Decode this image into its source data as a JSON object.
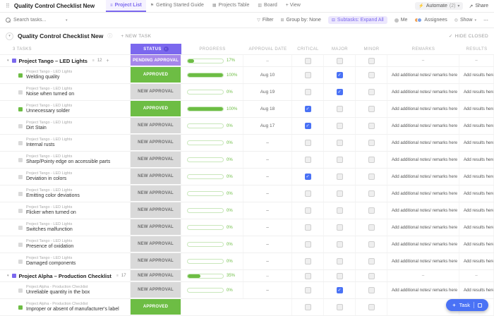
{
  "accent": "#7b68ee",
  "icons": {
    "grid": "⠿",
    "list": "≡",
    "guide": "⚑",
    "table": "▦",
    "board": "▥",
    "lightning": "⚡",
    "share": "↗",
    "caret": "▾",
    "filter": "▽",
    "group_by": "⊞",
    "subtasks": "⊟",
    "show": "◎",
    "more": "⋯",
    "info": "ⓘ",
    "check": "✓",
    "sort": "↑",
    "plus": "+",
    "collapse": "▾",
    "count_branch": "≡"
  },
  "topbar": {
    "title": "Quality Control Checklist New",
    "tabs": [
      {
        "label": "Project List"
      },
      {
        "label": "Getting Started Guide"
      },
      {
        "label": "Projects Table"
      },
      {
        "label": "Board"
      }
    ],
    "add_view": "+ View",
    "automate": "Automate",
    "automate_count": "(2)",
    "share": "Share"
  },
  "toolbar": {
    "search_placeholder": "Search tasks...",
    "filter": "Filter",
    "group_by": "Group by: None",
    "subtasks": "Subtasks: Expand All",
    "me": "Me",
    "assignees": "Assignees",
    "show": "Show"
  },
  "listbar": {
    "title": "Quality Control Checklist New",
    "new_task": "+ NEW TASK",
    "hide_closed": "HIDE CLOSED"
  },
  "table": {
    "tasks_count_label": "3 TASKS",
    "columns": {
      "status": "STATUS",
      "progress": "PROGRESS",
      "approval_date": "APPROVAL DATE",
      "critical": "CRITICAL",
      "major": "MAJOR",
      "minor": "MINOR",
      "remarks": "REMARKS",
      "results": "RESULTS"
    },
    "statuses": {
      "PENDING APPROVAL": {
        "bg": "#a687ea",
        "fg": "#ffffff"
      },
      "APPROVED": {
        "bg": "#6dbd44",
        "fg": "#ffffff"
      },
      "NEW APPROVAL": {
        "bg": "#d9d9d9",
        "fg": "#6e6e6e"
      }
    },
    "rows": [
      {
        "type": "group",
        "title": "Project Tango – LED Lights",
        "count": "12",
        "status": "PENDING APPROVAL",
        "progress": 17,
        "date": "–",
        "critical": false,
        "major": false,
        "minor": false,
        "remarks": "–",
        "results": "–"
      },
      {
        "type": "task",
        "parent": "Project Tango - LED Lights",
        "title": "Welding quality",
        "status": "APPROVED",
        "progress": 100,
        "date": "Aug 10",
        "critical": false,
        "major": true,
        "minor": false,
        "remarks": "Add additional notes/ remarks here",
        "results": "Add results here"
      },
      {
        "type": "task",
        "parent": "Project Tango - LED Lights",
        "title": "Noise when turned on",
        "status": "NEW APPROVAL",
        "progress": 0,
        "date": "Aug 19",
        "critical": false,
        "major": true,
        "minor": false,
        "remarks": "Add additional notes/ remarks here",
        "results": "Add results here"
      },
      {
        "type": "task",
        "parent": "Project Tango - LED Lights",
        "title": "Unnecessary solder",
        "status": "APPROVED",
        "progress": 100,
        "date": "Aug 18",
        "critical": true,
        "major": false,
        "minor": false,
        "remarks": "Add additional notes/ remarks here",
        "results": "Add results here"
      },
      {
        "type": "task",
        "parent": "Project Tango - LED Lights",
        "title": "Dirt Stain",
        "status": "NEW APPROVAL",
        "progress": 0,
        "date": "Aug 17",
        "critical": true,
        "major": false,
        "minor": false,
        "remarks": "Add additional notes/ remarks here",
        "results": "Add results here"
      },
      {
        "type": "task",
        "parent": "Project Tango - LED Lights",
        "title": "Internal rusts",
        "status": "NEW APPROVAL",
        "progress": 0,
        "date": "–",
        "critical": false,
        "major": false,
        "minor": false,
        "remarks": "Add additional notes/ remarks here",
        "results": "Add results here"
      },
      {
        "type": "task",
        "parent": "Project Tango - LED Lights",
        "title": "Sharp/Pointy edge on accessible parts",
        "status": "NEW APPROVAL",
        "progress": 0,
        "date": "–",
        "critical": false,
        "major": false,
        "minor": false,
        "remarks": "Add additional notes/ remarks here",
        "results": "Add results here"
      },
      {
        "type": "task",
        "parent": "Project Tango - LED Lights",
        "title": "Deviation in colors",
        "status": "NEW APPROVAL",
        "progress": 0,
        "date": "–",
        "critical": true,
        "major": false,
        "minor": false,
        "remarks": "Add additional notes/ remarks here",
        "results": "Add results here"
      },
      {
        "type": "task",
        "parent": "Project Tango - LED Lights",
        "title": "Emitting color deviations",
        "status": "NEW APPROVAL",
        "progress": 0,
        "date": "–",
        "critical": false,
        "major": false,
        "minor": false,
        "remarks": "Add additional notes/ remarks here",
        "results": "Add results here"
      },
      {
        "type": "task",
        "parent": "Project Tango - LED Lights",
        "title": "Flicker when turned on",
        "status": "NEW APPROVAL",
        "progress": 0,
        "date": "–",
        "critical": false,
        "major": false,
        "minor": false,
        "remarks": "Add additional notes/ remarks here",
        "results": "Add results here"
      },
      {
        "type": "task",
        "parent": "Project Tango - LED Lights",
        "title": "Switches malfunction",
        "status": "NEW APPROVAL",
        "progress": 0,
        "date": "–",
        "critical": false,
        "major": false,
        "minor": false,
        "remarks": "Add additional notes/ remarks here",
        "results": "Add results here"
      },
      {
        "type": "task",
        "parent": "Project Tango - LED Lights",
        "title": "Presence of oxidation",
        "status": "NEW APPROVAL",
        "progress": 0,
        "date": "–",
        "critical": false,
        "major": false,
        "minor": false,
        "remarks": "Add additional notes/ remarks here",
        "results": "Add results here"
      },
      {
        "type": "task",
        "parent": "Project Tango - LED Lights",
        "title": "Damaged components",
        "status": "NEW APPROVAL",
        "progress": 0,
        "date": "–",
        "critical": false,
        "major": false,
        "minor": false,
        "remarks": "Add additional notes/ remarks here",
        "results": "Add results here"
      },
      {
        "type": "group",
        "title": "Project Alpha – Production Checklist",
        "count": "17",
        "status": "NEW APPROVAL",
        "progress": 35,
        "date": "–",
        "critical": false,
        "major": false,
        "minor": false,
        "remarks": "–",
        "results": "–"
      },
      {
        "type": "task",
        "parent": "Project Alpha - Production Checklist",
        "title": "Unreliable quantity in the box",
        "status": "NEW APPROVAL",
        "progress": 0,
        "date": "–",
        "critical": false,
        "major": true,
        "minor": false,
        "remarks": "Add additional notes/ remarks here",
        "results": "Add results here"
      },
      {
        "type": "task",
        "parent": "Project Alpha - Production Checklist",
        "title": "Improper or absent of manufacturer's label",
        "status": "APPROVED",
        "progress": null,
        "date": "",
        "critical": false,
        "major": false,
        "minor": false,
        "remarks": "",
        "results": ""
      }
    ]
  },
  "fab": {
    "label": "Task"
  }
}
